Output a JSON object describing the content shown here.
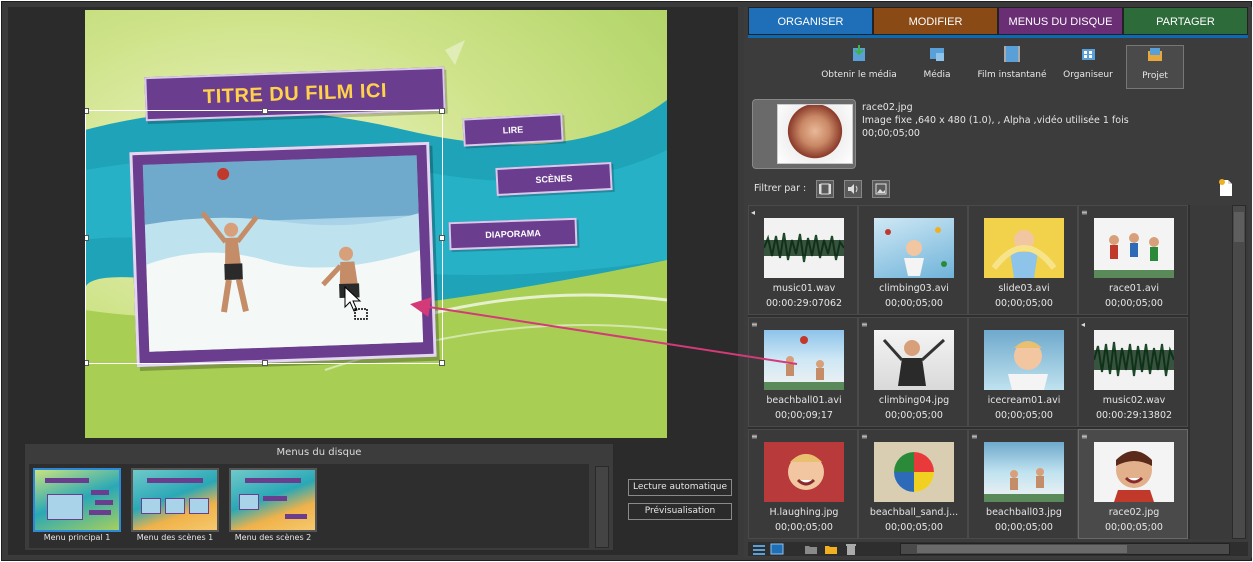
{
  "tabs": [
    {
      "label": "ORGANISER",
      "color": "#1f6fb8"
    },
    {
      "label": "MODIFIER",
      "color": "#8a4a16"
    },
    {
      "label": "MENUS DU DISQUE",
      "color": "#6a2e74"
    },
    {
      "label": "PARTAGER",
      "color": "#2d6b3a"
    }
  ],
  "toolbar": [
    {
      "label": "Obtenir le média",
      "icon": "get-media-icon"
    },
    {
      "label": "Média",
      "icon": "media-icon"
    },
    {
      "label": "Film instantané",
      "icon": "instant-movie-icon"
    },
    {
      "label": "Organiseur",
      "icon": "organizer-icon"
    },
    {
      "label": "Projet",
      "icon": "project-icon",
      "active": true
    }
  ],
  "info": {
    "filename": "race02.jpg",
    "details": "Image fixe ,640 x 480 (1.0), , Alpha  ,vidéo utilisée 1 fois",
    "duration": "00;00;05;00"
  },
  "filter": {
    "label": "Filtrer par :"
  },
  "media": [
    {
      "name": "music01.wav",
      "duration": "00:00:29:07062",
      "kind": "audio"
    },
    {
      "name": "climbing03.avi",
      "duration": "00;00;05;00",
      "kind": "photo"
    },
    {
      "name": "slide03.avi",
      "duration": "00;00;05;00",
      "kind": "photo"
    },
    {
      "name": "race01.avi",
      "duration": "00;00;05;00",
      "kind": "photo"
    },
    {
      "name": "beachball01.avi",
      "duration": "00;00;09;17",
      "kind": "photo"
    },
    {
      "name": "climbing04.jpg",
      "duration": "00;00;05;00",
      "kind": "photo"
    },
    {
      "name": "icecream01.avi",
      "duration": "00;00;05;00",
      "kind": "photo"
    },
    {
      "name": "music02.wav",
      "duration": "00:00:29:13802",
      "kind": "audio"
    },
    {
      "name": "H.laughing.jpg",
      "duration": "00;00;05;00",
      "kind": "photo"
    },
    {
      "name": "beachball_sand.j...",
      "duration": "00;00;05;00",
      "kind": "photo"
    },
    {
      "name": "beachball03.jpg",
      "duration": "00;00;05;00",
      "kind": "photo"
    },
    {
      "name": "race02.jpg",
      "duration": "00;00;05;00",
      "kind": "photo",
      "selected": true
    }
  ],
  "stage": {
    "title": "TITRE DU FILM ICI",
    "buttons": [
      "LIRE",
      "SCÈNES",
      "DIAPORAMA"
    ]
  },
  "disc_menus": {
    "title": "Menus du disque",
    "items": [
      "Menu principal 1",
      "Menu des scènes 1",
      "Menu des scènes 2"
    ]
  },
  "actions": {
    "autoplay": "Lecture automatique",
    "preview": "Prévisualisation"
  }
}
